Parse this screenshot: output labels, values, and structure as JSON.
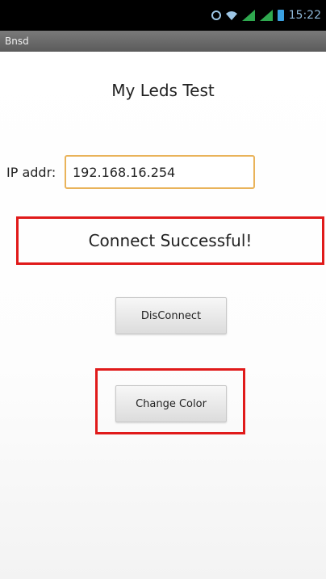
{
  "status_bar": {
    "time": "15:22",
    "icons": [
      "alarm-icon",
      "wifi-icon",
      "signal-icon",
      "signal-icon",
      "battery-icon"
    ]
  },
  "app_bar": {
    "title": "Bnsd"
  },
  "main": {
    "title": "My Leds Test",
    "ip_label": "IP addr:",
    "ip_value": "192.168.16.254",
    "status_text": "Connect Successful!",
    "disconnect_label": "DisConnect",
    "change_color_label": "Change Color"
  },
  "colors": {
    "highlight": "#e01a1a",
    "input_border": "#e9b35a"
  }
}
